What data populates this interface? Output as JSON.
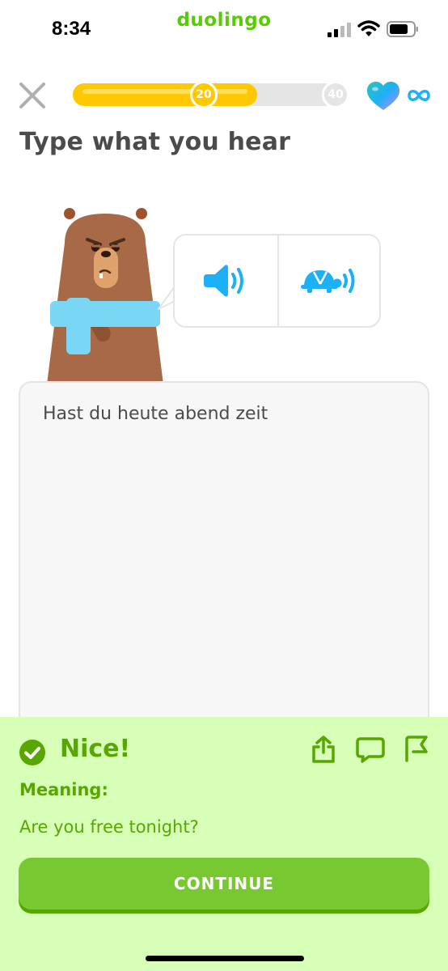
{
  "status_bar": {
    "time": "8:34",
    "app_name": "duolingo",
    "icons": [
      "cellular-signal-icon",
      "wifi-icon",
      "battery-icon"
    ]
  },
  "header": {
    "close_icon": "close-icon",
    "progress_fraction": 0.67,
    "milestones": [
      "20",
      "40"
    ],
    "hearts_icon": "heart-icon",
    "hearts_value": "infinity",
    "accent": "#ffc800"
  },
  "exercise": {
    "title": "Type what you hear",
    "audio_buttons": [
      "speaker-icon",
      "turtle-slow-speaker-icon"
    ],
    "answer": "Hast du heute abend zeit"
  },
  "feedback": {
    "title": "Nice!",
    "meaning_label": "Meaning:",
    "meaning_text": "Are you free tonight?",
    "actions": [
      "share-icon",
      "comment-icon",
      "flag-icon"
    ],
    "continue_label": "CONTINUE",
    "panel_color": "#d7ffb8",
    "text_color": "#58a700",
    "button_color": "#78c832"
  }
}
